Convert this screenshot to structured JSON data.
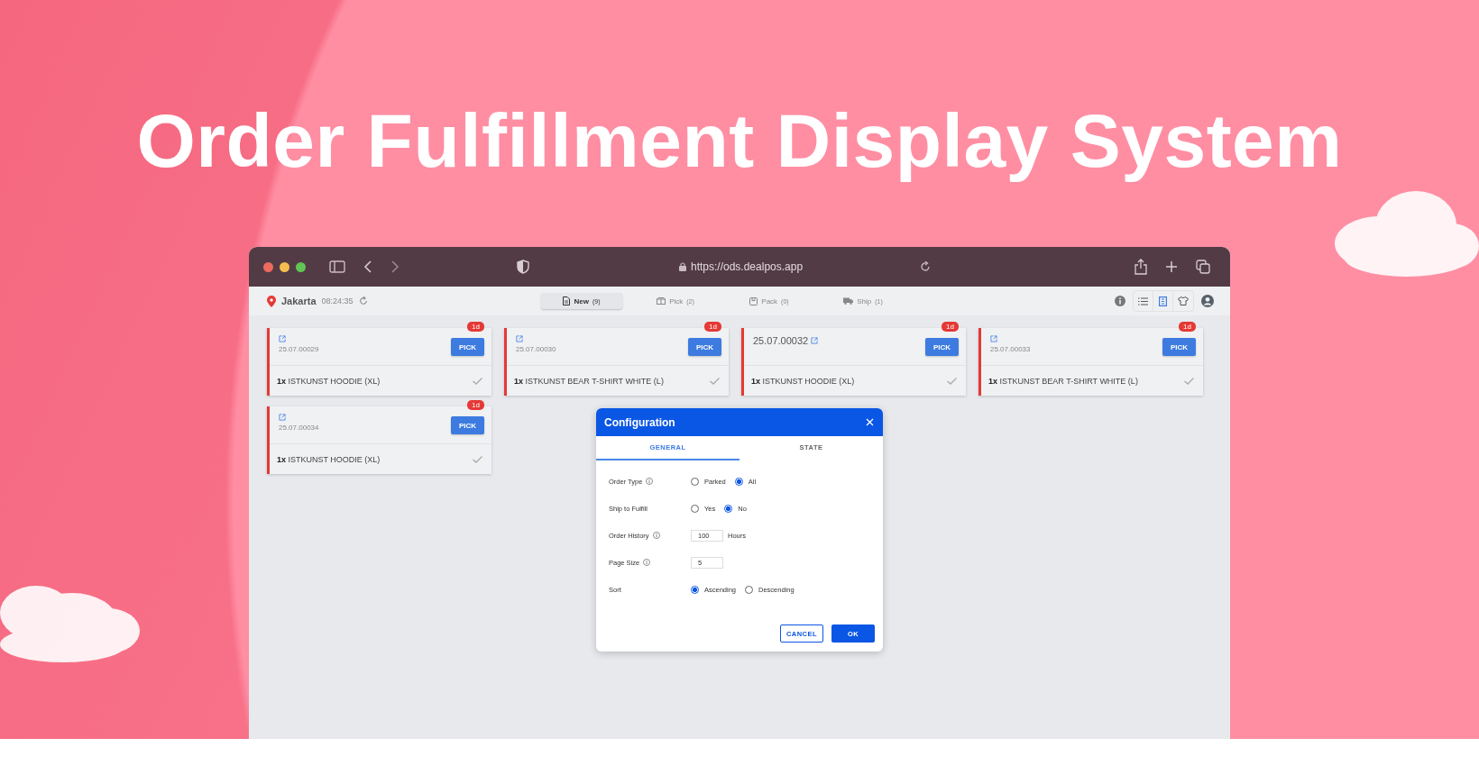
{
  "page_title": "Order Fulfillment Display System",
  "browser": {
    "url": "https://ods.dealpos.app"
  },
  "app_header": {
    "location": "Jakarta",
    "time": "08:24:35",
    "tabs": [
      {
        "label": "New",
        "count": "(9)",
        "selected": true
      },
      {
        "label": "Pick",
        "count": "(2)",
        "selected": false
      },
      {
        "label": "Pack",
        "count": "(0)",
        "selected": false
      },
      {
        "label": "Ship",
        "count": "(1)",
        "selected": false
      }
    ],
    "view_toggles": [
      {
        "selected": false
      },
      {
        "selected": true
      },
      {
        "selected": false
      }
    ]
  },
  "orders": [
    {
      "kind": "standard",
      "number": "25.07.00029",
      "age": "1d",
      "action": "PICK",
      "items": [
        {
          "qty": "1x",
          "name": "ISTKUNST HOODIE (XL)"
        }
      ]
    },
    {
      "kind": "standard",
      "number": "25.07.00030",
      "age": "1d",
      "action": "PICK",
      "items": [
        {
          "qty": "1x",
          "name": "ISTKUNST BEAR T-SHIRT WHITE (L)"
        }
      ]
    },
    {
      "kind": "highlighted",
      "number": "25.07.00032",
      "age": "1d",
      "action": "PICK",
      "items": [
        {
          "qty": "1x",
          "name": "ISTKUNST HOODIE (XL)"
        }
      ]
    },
    {
      "kind": "standard",
      "number": "25.07.00033",
      "age": "1d",
      "action": "PICK",
      "items": [
        {
          "qty": "1x",
          "name": "ISTKUNST BEAR T-SHIRT WHITE (L)"
        }
      ]
    },
    {
      "kind": "standard",
      "number": "25.07.00034",
      "age": "1d",
      "action": "PICK",
      "items": [
        {
          "qty": "1x",
          "name": "ISTKUNST HOODIE (XL)"
        }
      ]
    }
  ],
  "dialog": {
    "title": "Configuration",
    "tabs": [
      {
        "label": "GENERAL",
        "selected": true
      },
      {
        "label": "STATE",
        "selected": false
      }
    ],
    "fields": [
      {
        "kind": "radio",
        "label": "Order Type",
        "info": true,
        "options": [
          {
            "label": "Parked",
            "selected": false
          },
          {
            "label": "All",
            "selected": true
          }
        ]
      },
      {
        "kind": "radio",
        "label": "Ship to Fulfill",
        "info": false,
        "options": [
          {
            "label": "Yes",
            "selected": false
          },
          {
            "label": "No",
            "selected": true
          }
        ]
      },
      {
        "kind": "number",
        "label": "Order History",
        "info": true,
        "value": "100",
        "unit": "Hours"
      },
      {
        "kind": "number",
        "label": "Page Size",
        "info": true,
        "value": "5"
      },
      {
        "kind": "radio",
        "label": "Sort",
        "info": false,
        "options": [
          {
            "label": "Ascending",
            "selected": true
          },
          {
            "label": "Descending",
            "selected": false
          }
        ]
      }
    ],
    "buttons": [
      {
        "label": "CANCEL",
        "kind": "outline"
      },
      {
        "label": "OK",
        "kind": "primary"
      }
    ]
  }
}
